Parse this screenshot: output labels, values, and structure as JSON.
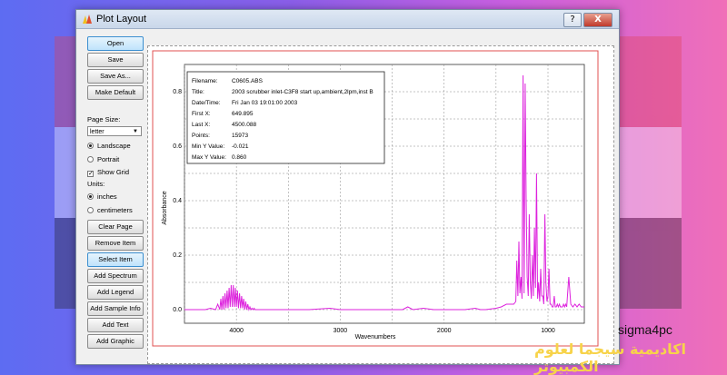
{
  "window": {
    "title": "Plot Layout",
    "help_label": "?",
    "close_label": "X"
  },
  "sidebar": {
    "buttons": {
      "open": "Open",
      "save": "Save",
      "save_as": "Save As...",
      "make_default": "Make Default",
      "clear_page": "Clear Page",
      "remove_item": "Remove Item",
      "select_item": "Select Item",
      "add_spectrum": "Add Spectrum",
      "add_legend": "Add Legend",
      "add_sample_info": "Add Sample Info",
      "add_text": "Add Text",
      "add_graphic": "Add Graphic"
    },
    "page_size_label": "Page Size:",
    "page_size_value": "letter",
    "orientation": {
      "landscape": "Landscape",
      "portrait": "Portrait",
      "selected": "landscape"
    },
    "show_grid": {
      "label": "Show Grid",
      "checked": true
    },
    "units": {
      "label": "Units:",
      "inches": "inches",
      "centimeters": "centimeters",
      "selected": "inches"
    }
  },
  "info_box": {
    "rows": [
      {
        "key": "Filename:",
        "value": "C0605.ABS"
      },
      {
        "key": "Title:",
        "value": "2003 scrubber inlet-C3F8 start up,ambient,2lpm,inst B"
      },
      {
        "key": "Date/Time:",
        "value": "Fri Jan 03 19:01:00 2003"
      },
      {
        "key": "First X:",
        "value": "649.895"
      },
      {
        "key": "Last X:",
        "value": "4500.088"
      },
      {
        "key": "Points:",
        "value": "15973"
      },
      {
        "key": "Min Y Value:",
        "value": "-0.021"
      },
      {
        "key": "Max Y Value:",
        "value": "0.860"
      }
    ]
  },
  "chart_data": {
    "type": "line",
    "xlabel": "Wavenumbers",
    "ylabel": "Absorbance",
    "xlim": [
      4500,
      650
    ],
    "ylim": [
      -0.05,
      0.9
    ],
    "x_ticks": [
      4000,
      3000,
      2000,
      1000
    ],
    "y_ticks": [
      "0.0",
      "0.2",
      "0.4",
      "0.6",
      "0.8"
    ],
    "grid": true,
    "colors": {
      "line": "#dd22dd",
      "frame": "#e05050"
    },
    "series": [
      {
        "x": [
          4500,
          4300,
          4250,
          4200,
          4180,
          4160,
          4150,
          4140,
          4130,
          4120,
          4110,
          4100,
          4090,
          4080,
          4070,
          4060,
          4050,
          4040,
          4030,
          4020,
          4010,
          4000,
          3990,
          3980,
          3970,
          3960,
          3950,
          3940,
          3930,
          3920,
          3910,
          3900,
          3890,
          3880,
          3870,
          3860,
          3850,
          3840,
          3830,
          3820,
          3800,
          3700,
          3500,
          3300,
          3100,
          3000,
          2900,
          2700,
          2500,
          2400,
          2350,
          2300,
          2200,
          2100,
          2000,
          1900,
          1800,
          1700,
          1650,
          1600,
          1500,
          1450,
          1400,
          1380,
          1350,
          1330,
          1310,
          1300,
          1290,
          1280,
          1270,
          1260,
          1250,
          1240,
          1230,
          1220,
          1210,
          1200,
          1190,
          1180,
          1170,
          1160,
          1150,
          1140,
          1130,
          1120,
          1110,
          1100,
          1090,
          1080,
          1070,
          1060,
          1050,
          1040,
          1030,
          1020,
          1010,
          1000,
          990,
          980,
          970,
          960,
          950,
          940,
          930,
          920,
          910,
          900,
          890,
          880,
          870,
          860,
          850,
          840,
          830,
          820,
          800,
          780,
          760,
          740,
          720,
          700,
          680,
          650
        ],
        "y": [
          0.0,
          0.0,
          0.005,
          0.0,
          0.02,
          0.0,
          0.04,
          0.0,
          0.05,
          0.0,
          0.06,
          0.005,
          0.07,
          0.005,
          0.08,
          0.01,
          0.09,
          0.01,
          0.09,
          0.01,
          0.08,
          0.01,
          0.07,
          0.005,
          0.06,
          0.005,
          0.05,
          0.005,
          0.04,
          0.0,
          0.03,
          0.0,
          0.02,
          0.0,
          0.01,
          0.0,
          0.005,
          0.0,
          0.005,
          0.0,
          0.0,
          0.0,
          0.0,
          0.0,
          0.005,
          0.0,
          0.0,
          0.0,
          0.0,
          0.0,
          0.01,
          0.0,
          0.005,
          0.0,
          0.0,
          0.0,
          0.0,
          0.005,
          0.0,
          0.0,
          0.005,
          0.01,
          0.02,
          0.02,
          0.02,
          0.02,
          0.03,
          0.18,
          0.05,
          0.25,
          0.06,
          0.12,
          0.04,
          0.86,
          0.06,
          0.83,
          0.4,
          0.12,
          0.05,
          0.35,
          0.1,
          0.04,
          0.2,
          0.05,
          0.3,
          0.08,
          0.5,
          0.04,
          0.1,
          0.03,
          0.15,
          0.05,
          0.05,
          0.02,
          0.35,
          0.1,
          0.03,
          0.05,
          0.15,
          0.02,
          0.02,
          0.01,
          0.01,
          0.05,
          0.01,
          0.01,
          0.02,
          0.01,
          0.02,
          0.01,
          0.01,
          0.01,
          0.02,
          0.01,
          0.02,
          0.01,
          0.12,
          0.02,
          0.01,
          0.02,
          0.01,
          0.02,
          0.01,
          0.01
        ]
      }
    ]
  },
  "watermark": {
    "text": "sigma4pc",
    "arabic": "اكاديمية سيجما لعلوم الكمبيوتر"
  }
}
